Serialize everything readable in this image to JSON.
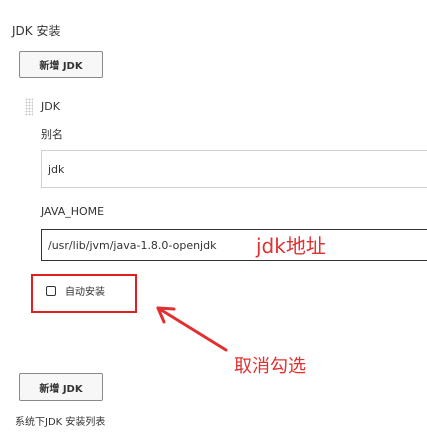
{
  "section": {
    "title": "JDK 安装"
  },
  "buttons": {
    "add_jdk_top": "新增 JDK",
    "add_jdk_bottom": "新增 JDK"
  },
  "jdk_entry": {
    "heading": "JDK",
    "alias_label": "别名",
    "alias_value": "jdk",
    "java_home_label": "JAVA_HOME",
    "java_home_value": "/usr/lib/jvm/java-1.8.0-openjdk",
    "auto_install_label": "自动安装",
    "auto_install_checked": false
  },
  "annotations": {
    "jdk_address": "jdk地址",
    "uncheck_hint": "取消勾选",
    "accent_color": "#e03030"
  },
  "footer": {
    "hint": "系统下JDK 安装列表"
  }
}
